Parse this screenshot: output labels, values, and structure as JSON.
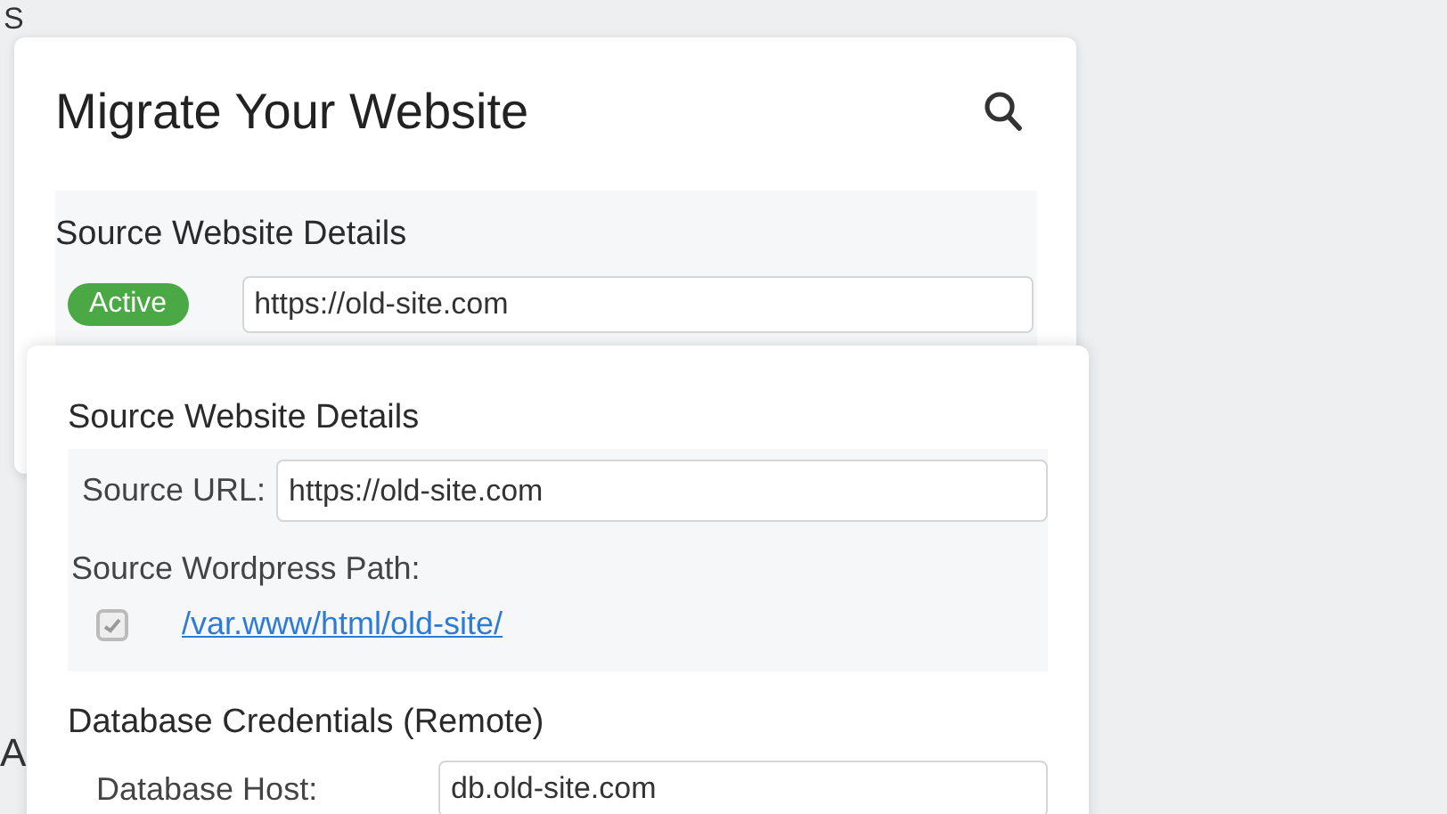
{
  "background": {
    "heading_fragment": "S",
    "side_fragment": "A"
  },
  "back_card": {
    "title": "Migrate Your Website",
    "section": {
      "heading": "Source Website Details",
      "status": {
        "label": "Active",
        "kind": "success"
      },
      "url": "https://old-site.com"
    }
  },
  "front_card": {
    "source": {
      "heading": "Source Website Details",
      "url_label": "Source URL:",
      "url": "https://old-site.com",
      "path_label": "Source Wordpress Path:",
      "path_checked": true,
      "path_link": "/var.www/html/old-site/"
    },
    "database": {
      "heading": "Database Credentials (Remote)",
      "host_label": "Database Host:",
      "host": "db.old-site.com"
    }
  }
}
